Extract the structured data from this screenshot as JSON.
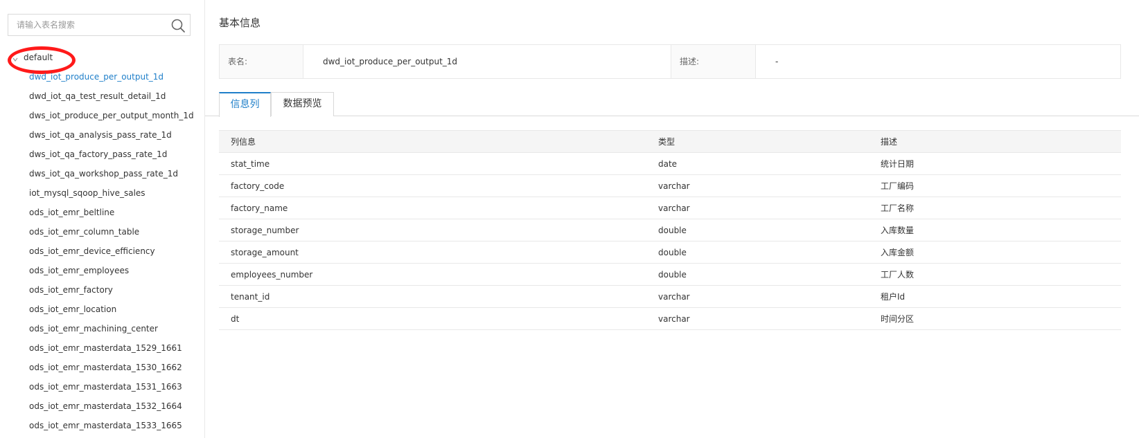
{
  "sidebar": {
    "search_placeholder": "请输入表名搜索",
    "root_label": "default",
    "tables": [
      "dwd_iot_produce_per_output_1d",
      "dwd_iot_qa_test_result_detail_1d",
      "dws_iot_produce_per_output_month_1d",
      "dws_iot_qa_analysis_pass_rate_1d",
      "dws_iot_qa_factory_pass_rate_1d",
      "dws_iot_qa_workshop_pass_rate_1d",
      "iot_mysql_sqoop_hive_sales",
      "ods_iot_emr_beltline",
      "ods_iot_emr_column_table",
      "ods_iot_emr_device_efficiency",
      "ods_iot_emr_employees",
      "ods_iot_emr_factory",
      "ods_iot_emr_location",
      "ods_iot_emr_machining_center",
      "ods_iot_emr_masterdata_1529_1661",
      "ods_iot_emr_masterdata_1530_1662",
      "ods_iot_emr_masterdata_1531_1663",
      "ods_iot_emr_masterdata_1532_1664",
      "ods_iot_emr_masterdata_1533_1665"
    ],
    "active_index": 0
  },
  "main": {
    "section_title": "基本信息",
    "info": {
      "table_name_label": "表名:",
      "table_name_value": "dwd_iot_produce_per_output_1d",
      "desc_label": "描述:",
      "desc_value": "-"
    },
    "tabs": {
      "columns": "信息列",
      "preview": "数据预览"
    },
    "columns_table": {
      "headers": [
        "列信息",
        "类型",
        "描述"
      ],
      "rows": [
        [
          "stat_time",
          "date",
          "统计日期"
        ],
        [
          "factory_code",
          "varchar",
          "工厂编码"
        ],
        [
          "factory_name",
          "varchar",
          "工厂名称"
        ],
        [
          "storage_number",
          "double",
          "入库数量"
        ],
        [
          "storage_amount",
          "double",
          "入库金额"
        ],
        [
          "employees_number",
          "double",
          "工厂人数"
        ],
        [
          "tenant_id",
          "varchar",
          "租户Id"
        ],
        [
          "dt",
          "varchar",
          "时间分区"
        ]
      ]
    }
  },
  "colors": {
    "accent": "#1f7fc9",
    "highlight_circle": "#ff1a1a"
  },
  "icons": {
    "search": "search-icon",
    "caret": "caret-down-icon"
  }
}
